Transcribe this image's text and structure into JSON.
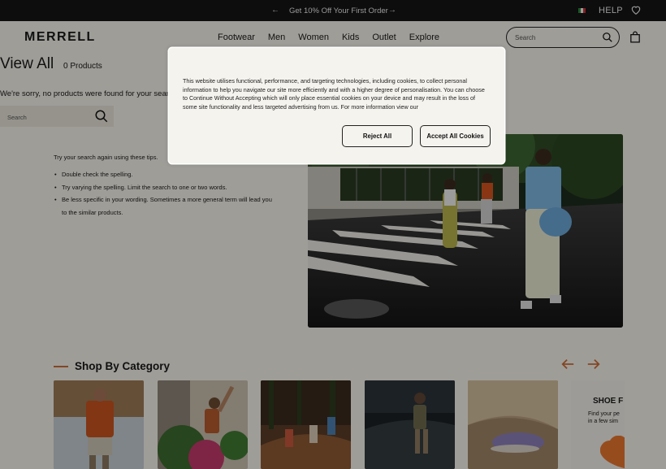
{
  "promo_bar": {
    "message": "Get 10% Off Your First Order",
    "help_label": "HELP"
  },
  "header": {
    "logo": "MERRELL",
    "nav": [
      "Footwear",
      "Men",
      "Women",
      "Kids",
      "Outlet",
      "Explore"
    ],
    "search_placeholder": "Search"
  },
  "results": {
    "title": "View All",
    "count_label": "0 Products",
    "no_results_message": "We're sorry, no products were found for your search",
    "search_placeholder": "Search",
    "tips_heading": "Try your search again using these tips.",
    "tips": [
      "Double check the spelling.",
      "Try varying the spelling. Limit the search to one or two words.",
      "Be less specific in your wording. Sometimes a more general term will lead you to the similar products."
    ]
  },
  "category_section": {
    "title": "Shop By Category",
    "shoe_finder_title": "SHOE F",
    "shoe_finder_lines": [
      "Find your pe",
      "in a few sim"
    ]
  },
  "cookie_modal": {
    "body": "This website utilises functional, performance, and targeting technologies, including cookies, to collect personal information to help you navigate our site more efficiently and with a higher degree of personalisation. You can choose to Continue Without Accepting which will only place essential cookies on your device and may result in the loss of some site functionality and less targeted advertising from us. For more information view our",
    "reject_label": "Reject All",
    "accept_label": "Accept All Cookies"
  },
  "colors": {
    "accent": "#c86d3a",
    "background": "#f4f1ea",
    "promo_bar": "#141414"
  },
  "icons": [
    "arrow-left-icon",
    "arrow-right-icon",
    "flag-icon",
    "heart-icon",
    "search-icon",
    "bag-icon"
  ]
}
